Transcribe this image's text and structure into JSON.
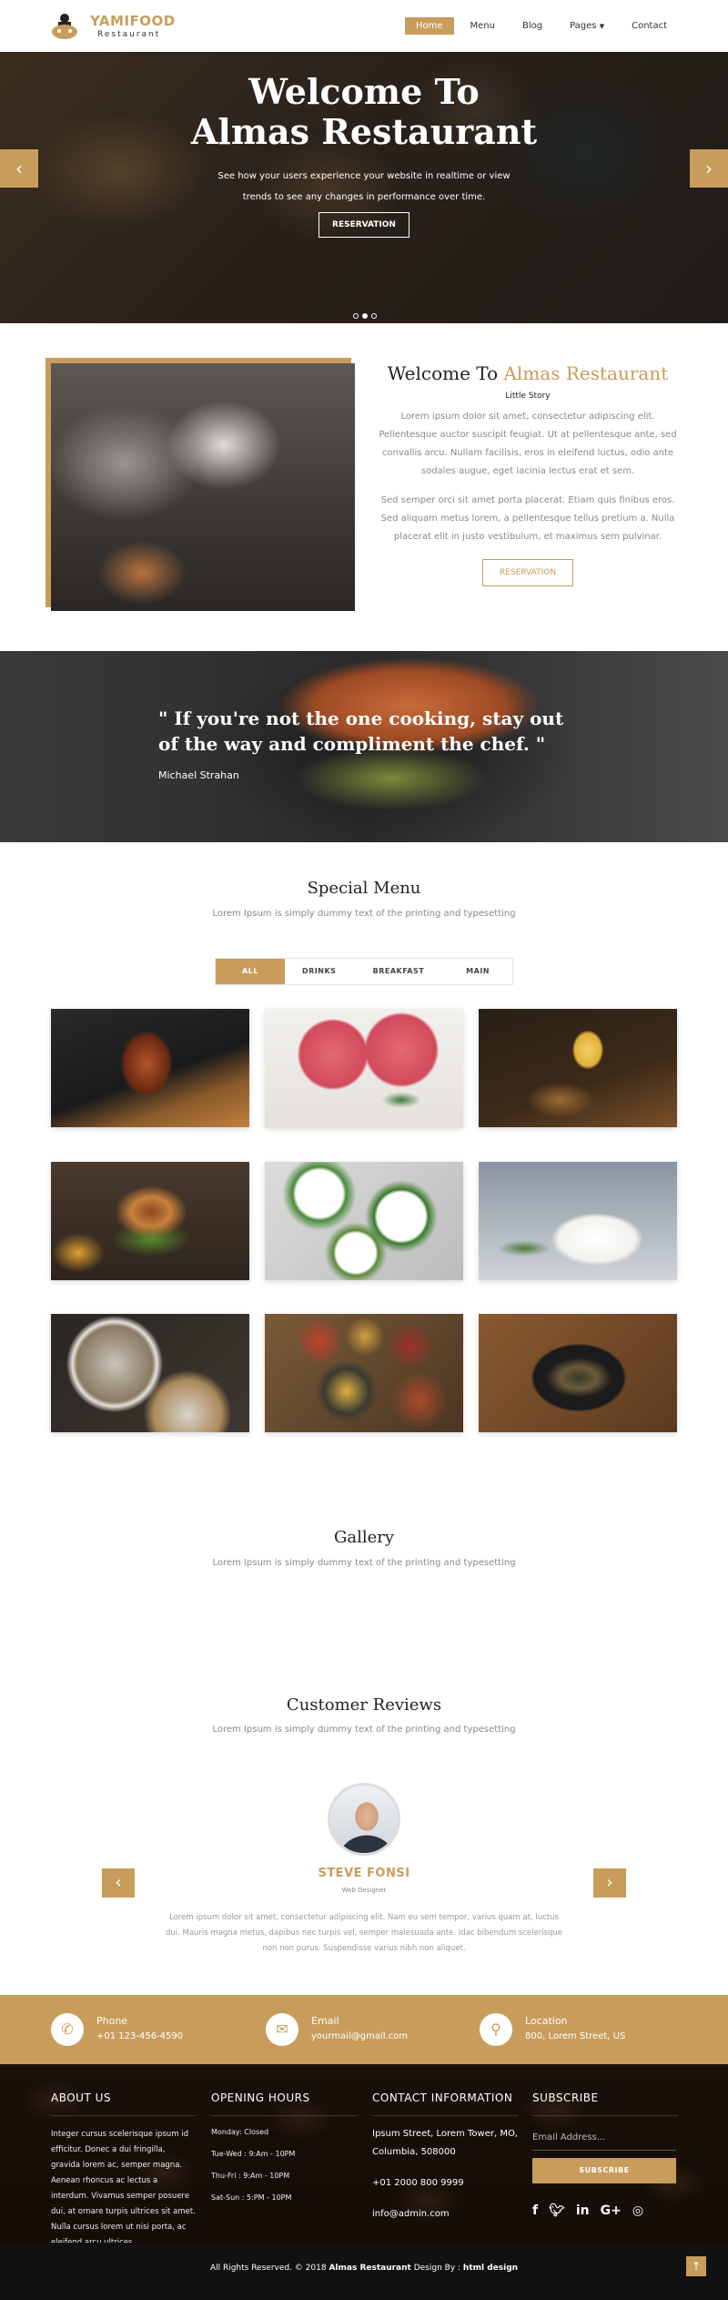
{
  "nav": {
    "brand": "YAMIFOOD",
    "brand_sub": "Restaurant",
    "items": [
      {
        "label": "Home"
      },
      {
        "label": "Menu"
      },
      {
        "label": "Blog"
      },
      {
        "label": "Pages"
      },
      {
        "label": "Contact"
      }
    ]
  },
  "hero": {
    "title_line1": "Welcome To",
    "title_line2": "Almas Restaurant",
    "text_line1": "See how your users experience your website in realtime or view",
    "text_line2": "trends to see any changes in performance over time.",
    "button": "RESERVATION",
    "prev": "‹",
    "next": "›"
  },
  "about": {
    "title_a": "Welcome To",
    "title_b": "Almas Restaurant",
    "subtitle": "Little Story",
    "para1": "Lorem ipsum dolor sit amet, consectetur adipiscing elit. Pellentesque auctor suscipit feugiat. Ut at pellentesque ante, sed convallis arcu. Nullam facilisis, eros in eleifend luctus, odio ante sodales augue, eget lacinia lectus erat et sem.",
    "para2": "Sed semper orci sit amet porta placerat. Etiam quis finibus eros. Sed aliquam metus lorem, a pellentesque tellus pretium a. Nulla placerat elit in justo vestibulum, et maximus sem pulvinar.",
    "button": "RESERVATION"
  },
  "quote": {
    "text": "\" If you're not the one cooking, stay out of the way and compliment the chef. \"",
    "author": "Michael Strahan"
  },
  "menu": {
    "title": "Special Menu",
    "subtitle": "Lorem Ipsum is simply dummy text of the printing and typesetting",
    "tabs": [
      {
        "label": "ALL"
      },
      {
        "label": "DRINKS"
      },
      {
        "label": "BREAKFAST"
      },
      {
        "label": "MAIN"
      }
    ]
  },
  "gallery": {
    "title": "Gallery",
    "subtitle": "Lorem Ipsum is simply dummy text of the printing and typesetting"
  },
  "reviews": {
    "title": "Customer Reviews",
    "subtitle": "Lorem Ipsum is simply dummy text of the printing and typesetting",
    "name": "STEVE FONSI",
    "role": "Web Designer",
    "text": "Lorem ipsum dolor sit amet, consectetur adipiscing elit. Nam eu sem tempor, varius quam at, luctus dui. Mauris magna metus, dapibus nec turpis vel, semper malesuada ante. Idac bibendum scelerisque non non purus. Suspendisse varius nibh non aliquet.",
    "prev": "‹",
    "next": "›"
  },
  "contact": {
    "phone_label": "Phone",
    "phone": "+01 123-456-4590",
    "email_label": "Email",
    "email": "yourmail@gmail.com",
    "location_label": "Location",
    "location": "800, Lorem Street, US"
  },
  "footer": {
    "about_title": "ABOUT US",
    "about_text": "Integer cursus scelerisque ipsum id efficitur. Donec a dui fringilla, gravida lorem ac, semper magna. Aenean rhoncus ac lectus a interdum. Vivamus semper posuere dui, at ornare turpis ultrices sit amet. Nulla cursus lorem ut nisi porta, ac eleifend arcu ultrices.",
    "hours_title": "OPENING HOURS",
    "hours": [
      "Monday: Closed",
      "Tue-Wed : 9:Am - 10PM",
      "Thu-Fri : 9:Am - 10PM",
      "Sat-Sun : 5:PM - 10PM"
    ],
    "contact_title": "CONTACT INFORMATION",
    "address": "Ipsum Street, Lorem Tower, MO, Columbia, 508000",
    "phone": "+01 2000 800 9999",
    "email": "info@admin.com",
    "subscribe_title": "SUBSCRIBE",
    "subscribe_placeholder": "Email Address...",
    "subscribe_button": "SUBSCRIBE",
    "social": [
      "f",
      "t",
      "in",
      "G+",
      "◎"
    ]
  },
  "copyright": {
    "a": "All Rights Reserved. © 2018 ",
    "b": "Almas Restaurant",
    "c": " Design By : ",
    "d": "html design"
  },
  "colors": {
    "accent": "#c89d5c",
    "dark": "#222222",
    "footer_bar": "#111111"
  }
}
